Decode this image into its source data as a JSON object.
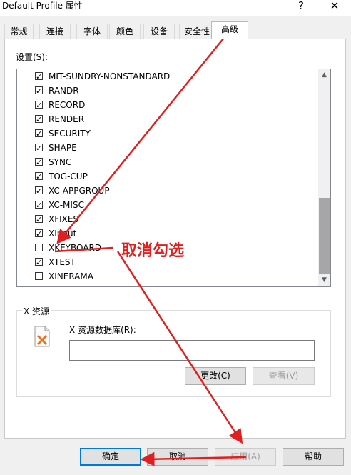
{
  "window": {
    "title": "Default Profile 属性",
    "help_glyph": "?",
    "close_glyph": "✕"
  },
  "tabs": [
    {
      "label": "常规"
    },
    {
      "label": "连接"
    },
    {
      "label": "字体"
    },
    {
      "label": "颜色"
    },
    {
      "label": "设备"
    },
    {
      "label": "安全性"
    },
    {
      "label": "高级",
      "active": true
    }
  ],
  "settings": {
    "label": "设置(S):",
    "items": [
      {
        "label": "MIT-SUNDRY-NONSTANDARD",
        "checked": true
      },
      {
        "label": "RANDR",
        "checked": true
      },
      {
        "label": "RECORD",
        "checked": true
      },
      {
        "label": "RENDER",
        "checked": true
      },
      {
        "label": "SECURITY",
        "checked": true
      },
      {
        "label": "SHAPE",
        "checked": true
      },
      {
        "label": "SYNC",
        "checked": true
      },
      {
        "label": "TOG-CUP",
        "checked": true
      },
      {
        "label": "XC-APPGROUP",
        "checked": true
      },
      {
        "label": "XC-MISC",
        "checked": true
      },
      {
        "label": "XFIXES",
        "checked": true
      },
      {
        "label": "XInput",
        "checked": true
      },
      {
        "label": "XKEYBOARD",
        "checked": false
      },
      {
        "label": "XTEST",
        "checked": true
      },
      {
        "label": "XINERAMA",
        "checked": false
      }
    ]
  },
  "resources": {
    "group_title": "X 资源",
    "db_label": "X 资源数据库(R):",
    "db_value": "",
    "change_button": "更改(C)",
    "view_button": "查看(V)"
  },
  "footer": {
    "ok": "确定",
    "cancel": "取消",
    "apply": "应用(A)",
    "help": "帮助"
  },
  "annotation": {
    "text": "取消勾选",
    "color": "#e02020"
  }
}
